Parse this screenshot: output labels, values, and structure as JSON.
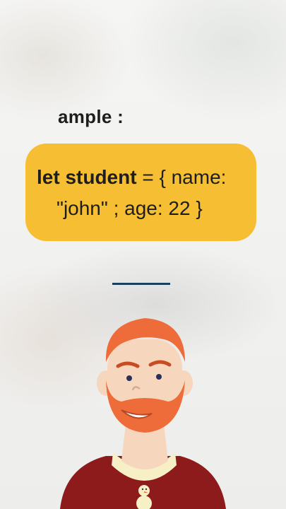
{
  "example_label": "ample :",
  "code": {
    "keyword": "let student",
    "line1_rest": " = { name:",
    "line2": "\"john\" ; age: 22 }"
  },
  "colors": {
    "bubble": "#f5be33",
    "hair": "#ee6b3a",
    "shirt": "#8e1b1b",
    "divider": "#1c3f5e"
  },
  "icons": {
    "presenter": "presenter-avatar",
    "snowman": "snowman-icon"
  }
}
